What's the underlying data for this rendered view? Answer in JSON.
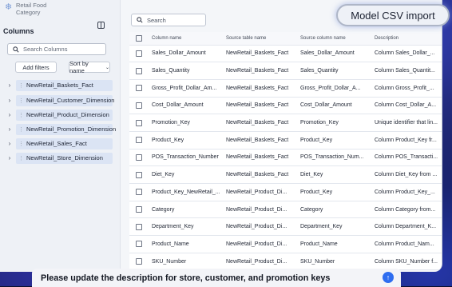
{
  "brand": {
    "line1": "Retail Food",
    "line2": "Category"
  },
  "sidebar": {
    "title": "Columns",
    "search_placeholder": "Search Columns",
    "add_filters": "Add filters",
    "sort_label": "Sort by name",
    "tables": [
      "NewRetail_Baskets_Fact",
      "NewRetail_Customer_Dimension",
      "NewRetail_Product_Dimension",
      "NewRetail_Promotion_Dimension",
      "NewRetail_Sales_Fact",
      "NewRetail_Store_Dimension"
    ]
  },
  "search": {
    "placeholder": "Search"
  },
  "table": {
    "headers": [
      "Column name",
      "Source table name",
      "Source column name",
      "Description"
    ],
    "rows": [
      [
        "Sales_Dollar_Amount",
        "NewRetail_Baskets_Fact",
        "Sales_Dollar_Amount",
        "Column Sales_Dollar_..."
      ],
      [
        "Sales_Quantity",
        "NewRetail_Baskets_Fact",
        "Sales_Quantity",
        "Column Sales_Quantit..."
      ],
      [
        "Gross_Profit_Dollar_Am...",
        "NewRetail_Baskets_Fact",
        "Gross_Profit_Dollar_A...",
        "Column Gross_Profit_..."
      ],
      [
        "Cost_Dollar_Amount",
        "NewRetail_Baskets_Fact",
        "Cost_Dollar_Amount",
        "Column Cost_Dollar_A..."
      ],
      [
        "Promotion_Key",
        "NewRetail_Baskets_Fact",
        "Promotion_Key",
        "Unique identifier that lin..."
      ],
      [
        "Product_Key",
        "NewRetail_Baskets_Fact",
        "Product_Key",
        "Column Product_Key fr..."
      ],
      [
        "POS_Transaction_Number",
        "NewRetail_Baskets_Fact",
        "POS_Transaction_Num...",
        "Column POS_Transacti..."
      ],
      [
        "Diet_Key",
        "NewRetail_Baskets_Fact",
        "Diet_Key",
        "Column Diet_Key from ..."
      ],
      [
        "Product_Key_NewRetail_...",
        "NewRetail_Product_Di...",
        "Product_Key",
        "Column Product_Key_..."
      ],
      [
        "Category",
        "NewRetail_Product_Di...",
        "Category",
        "Column Category from..."
      ],
      [
        "Department_Key",
        "NewRetail_Product_Di...",
        "Department_Key",
        "Column Department_K..."
      ],
      [
        "Product_Name",
        "NewRetail_Product_Di...",
        "Product_Name",
        "Column Product_Nam..."
      ],
      [
        "SKU_Number",
        "NewRetail_Product_Di...",
        "SKU_Number",
        "Column SKU_Number f..."
      ]
    ]
  },
  "callouts": {
    "model_badge": "Model CSV import",
    "prompt": "Please update the description for store, customer, and promotion keys",
    "send_icon": "arrow-up-icon"
  },
  "colors": {
    "accent": "#2e6df0",
    "selected_table_bg": "#dbe4f4",
    "background": "#0d1238"
  }
}
